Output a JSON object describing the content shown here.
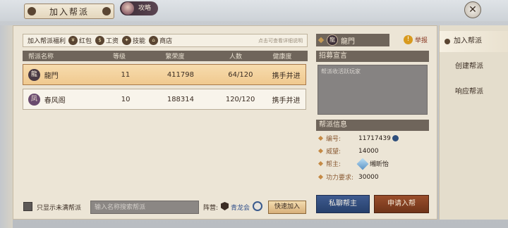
{
  "header": {
    "title": "加入帮派",
    "strategy_label": "攻略",
    "close_icon": "close-x-icon"
  },
  "welfare": {
    "label": "加入帮派福利",
    "items": [
      {
        "label": "红包",
        "icon": "red-envelope-icon",
        "glyph": "¥"
      },
      {
        "label": "工资",
        "icon": "wage-icon",
        "glyph": "$"
      },
      {
        "label": "技能",
        "icon": "skill-icon",
        "glyph": "✦"
      },
      {
        "label": "商店",
        "icon": "shop-icon",
        "glyph": "⌂"
      }
    ],
    "hint": "点击可查看详细说明"
  },
  "table": {
    "headers": {
      "name": "帮派名称",
      "level": "等级",
      "fame": "繁荣度",
      "count": "人数",
      "health": "健康度"
    },
    "rows": [
      {
        "emblem": "龍",
        "name": "龍門",
        "level": "11",
        "fame": "411798",
        "count": "64/120",
        "health": "携手并进",
        "selected": true
      },
      {
        "emblem": "凤",
        "name": "春风阁",
        "level": "10",
        "fame": "188314",
        "count": "120/120",
        "health": "携手并进",
        "selected": false
      }
    ]
  },
  "filter": {
    "only_not_full_label": "只显示未满帮派",
    "checked": true
  },
  "search": {
    "placeholder": "输入名称搜索帮派"
  },
  "camp": {
    "label": "阵营:",
    "name": "青龙会"
  },
  "quick_join_label": "快速加入",
  "detail": {
    "emblem": "龍",
    "guild_name": "龍門",
    "report_label": "举报",
    "recruit_title": "招募宣言",
    "recruit_text": "帮派收活跃玩家",
    "info_title": "帮派信息",
    "info": {
      "id_label": "编号:",
      "id_value": "11717439",
      "fame_label": "威望:",
      "fame_value": "14000",
      "leader_label": "帮主:",
      "leader_value": "缃昕怡",
      "power_label": "功力要求:",
      "power_value": "30000"
    },
    "btn_message_leader": "私聊帮主",
    "btn_apply": "申请入帮"
  },
  "side_tabs": [
    {
      "label": "加入帮派",
      "active": true
    },
    {
      "label": "创建帮派",
      "active": false
    },
    {
      "label": "响应帮派",
      "active": false
    }
  ],
  "colors": {
    "selected_row": "#f0c98f",
    "header_bar": "#6f655b",
    "leader_button": "#27406c",
    "apply_button": "#6f3419"
  }
}
